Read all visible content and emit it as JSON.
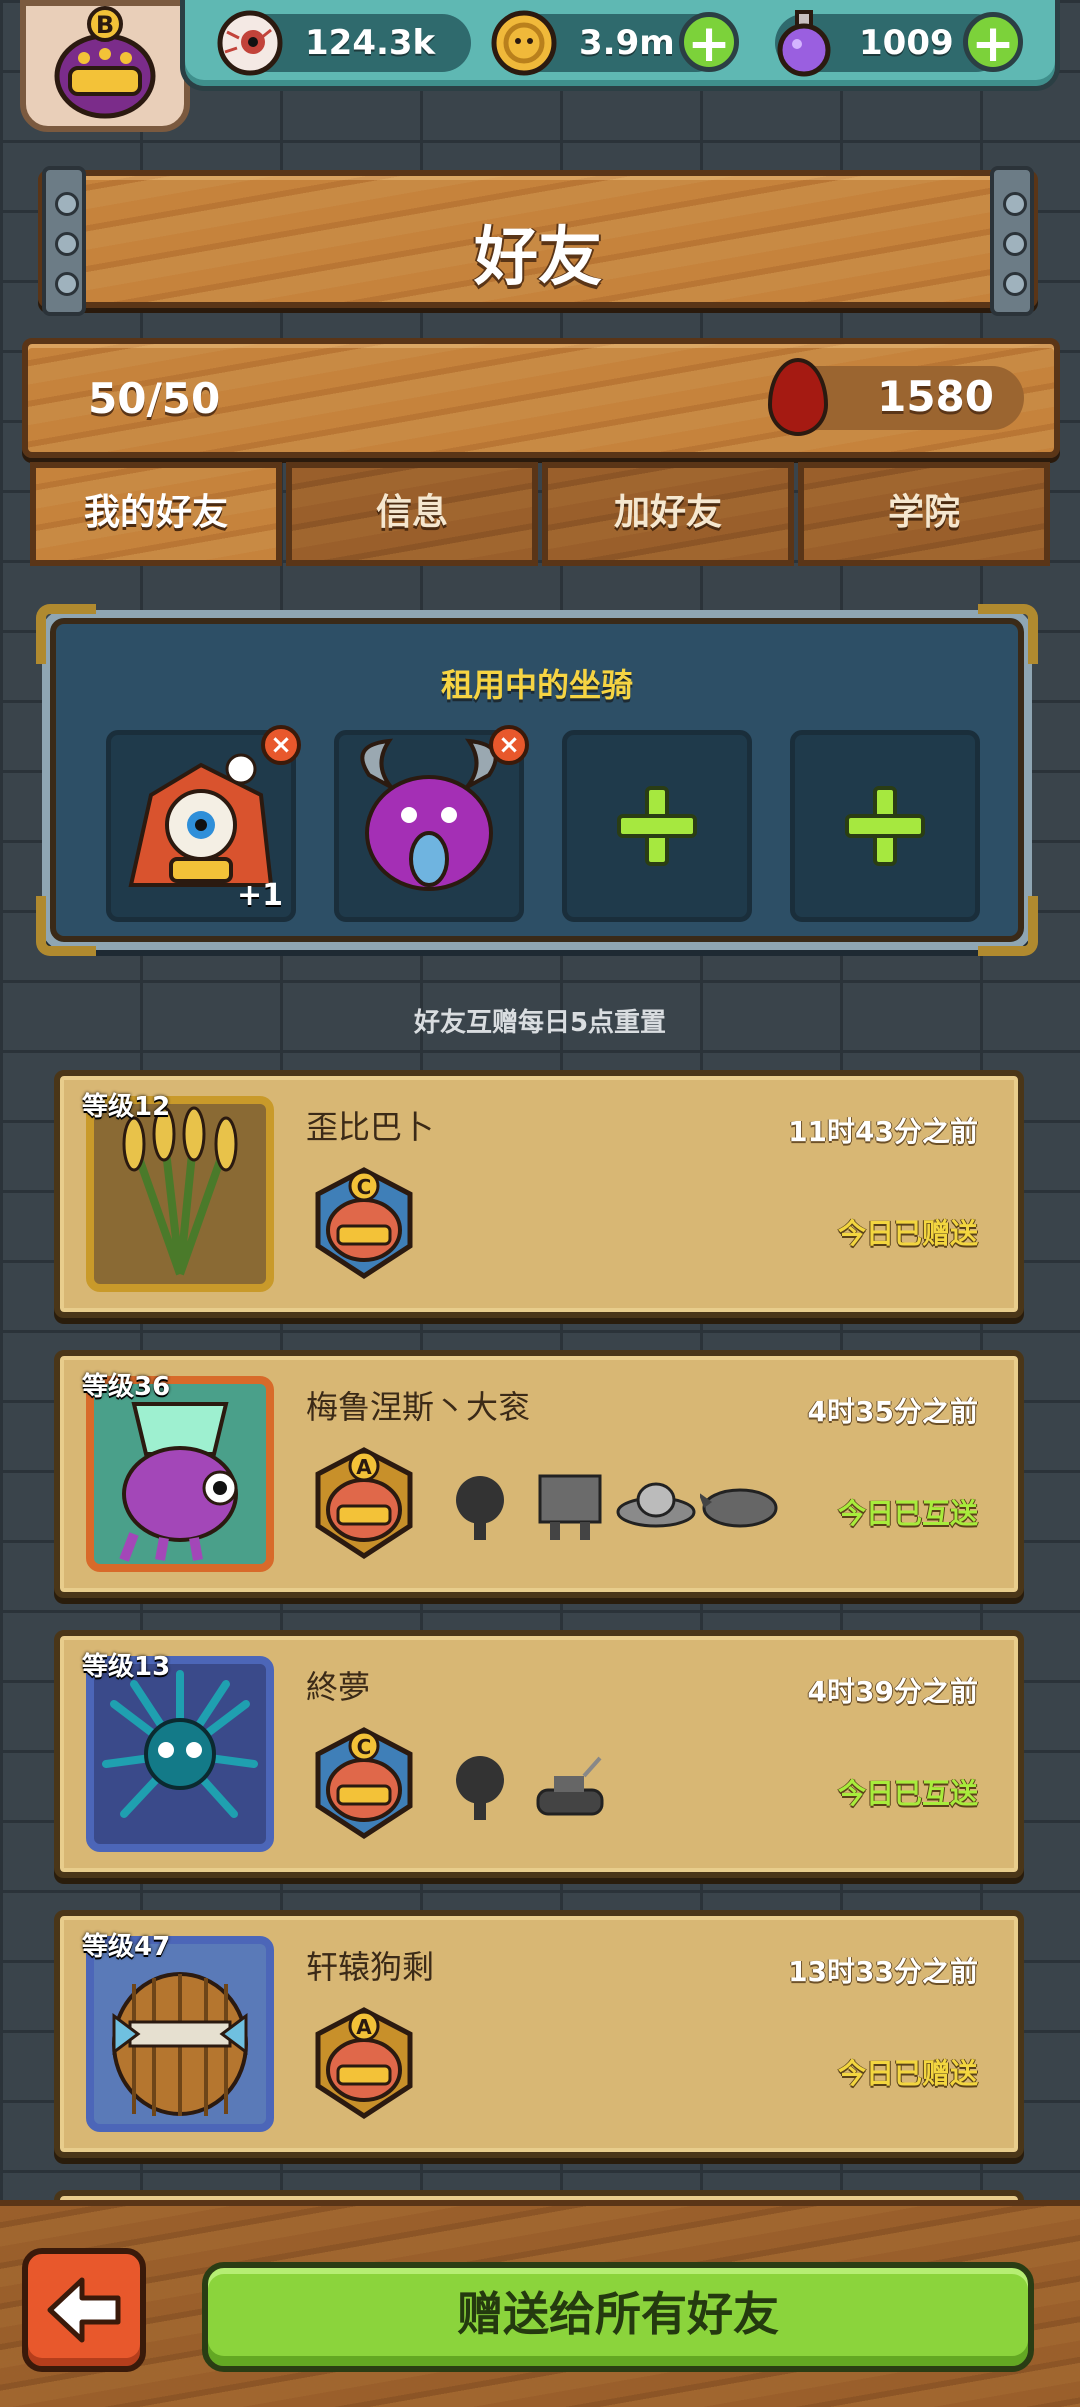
{
  "resources": {
    "eyes": "124.3k",
    "coins": "3.9m",
    "potions": "1009",
    "avatar_rank": "B"
  },
  "header": {
    "title": "好友"
  },
  "stats": {
    "friend_count": "50/50",
    "blood": "1580"
  },
  "tabs": [
    {
      "label": "我的好友",
      "active": true
    },
    {
      "label": "信息"
    },
    {
      "label": "加好友"
    },
    {
      "label": "学院"
    }
  ],
  "mounts": {
    "title": "租用中的坐骑",
    "slot1_bonus": "+1"
  },
  "reset_note": "好友互赠每日5点重置",
  "friends": [
    {
      "level": "等级12",
      "name": "歪比巴卜",
      "time": "11时43分之前",
      "status": "今日已赠送",
      "rank": "C"
    },
    {
      "level": "等级36",
      "name": "梅鲁涅斯丶大衮",
      "time": "4时35分之前",
      "status": "今日已互送",
      "rank": "A"
    },
    {
      "level": "等级13",
      "name": "終夢",
      "time": "4时39分之前",
      "status": "今日已互送",
      "rank": "C"
    },
    {
      "level": "等级47",
      "name": "轩辕狗剩",
      "time": "13时33分之前",
      "status": "今日已赠送",
      "rank": "A"
    }
  ],
  "actions": {
    "gift_all": "赠送给所有好友"
  },
  "colors": {
    "gifted": "#f3d640",
    "mutual": "#a8ec3c",
    "accent_green": "#8bd43c"
  }
}
